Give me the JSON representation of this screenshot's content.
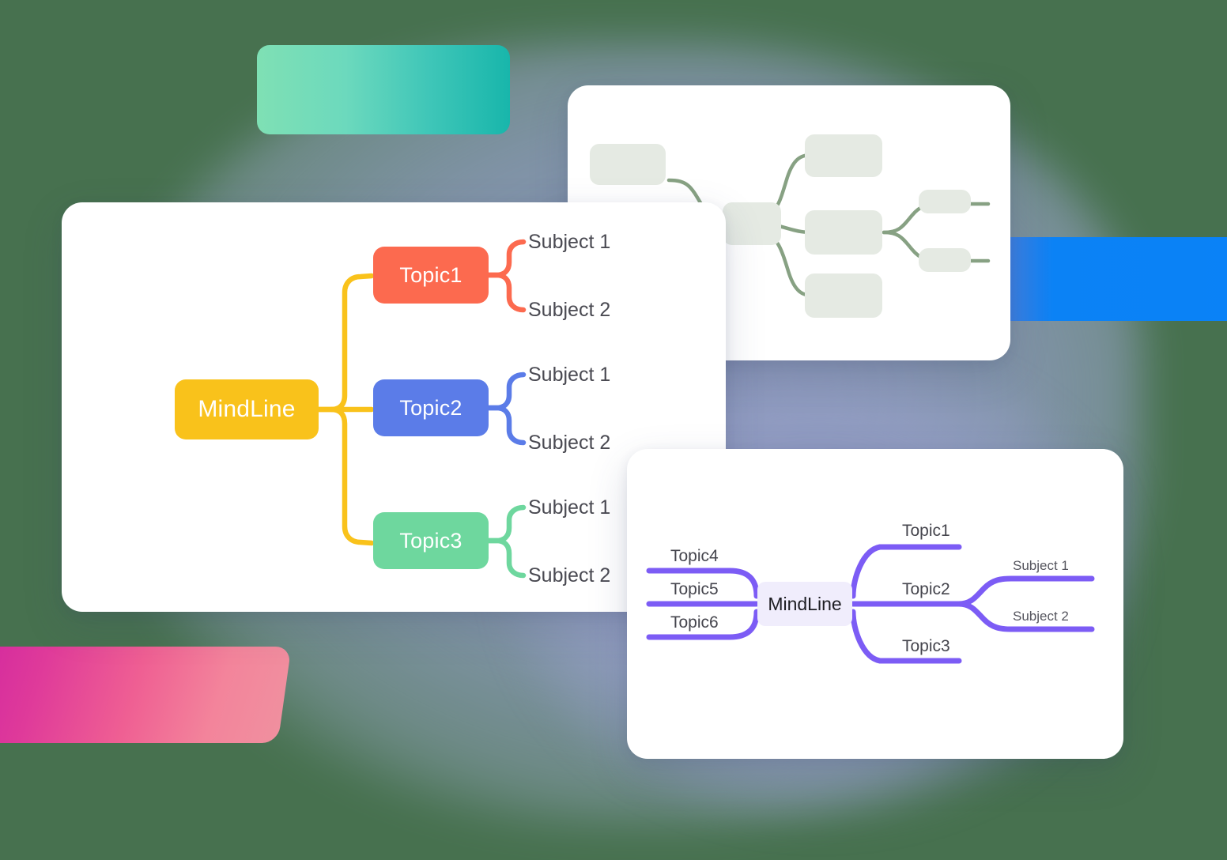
{
  "page": {
    "background_color": "#47714f",
    "title": "MindLine mind-map illustration"
  },
  "decor": {
    "green_blob": {
      "from": "#7fe0b4",
      "to": "#18b6ab"
    },
    "blue_blob": {
      "from": "#3b7fe2",
      "to": "#0a82f7"
    },
    "pink_blob": {
      "from": "#d2289f",
      "to": "#f0909f"
    },
    "haze_blob": {
      "color": "#8e96c4"
    }
  },
  "main_card": {
    "accent_root": "#f9c21b",
    "root": {
      "label": "MindLine"
    },
    "branches": [
      {
        "label": "Topic1",
        "color": "#fc6a4f",
        "leaves": [
          {
            "label": "Subject 1"
          },
          {
            "label": "Subject 2"
          }
        ]
      },
      {
        "label": "Topic2",
        "color": "#5b7ce8",
        "leaves": [
          {
            "label": "Subject 1"
          },
          {
            "label": "Subject 2"
          }
        ]
      },
      {
        "label": "Topic3",
        "color": "#6ed79e",
        "leaves": [
          {
            "label": "Subject 1"
          },
          {
            "label": "Subject 2"
          }
        ]
      }
    ]
  },
  "top_right_card": {
    "line_color": "#87a183",
    "box_color": "#e5eae3",
    "nodes": [
      {
        "name": "placeholder-left",
        "label": ""
      },
      {
        "name": "placeholder-center-root",
        "label": ""
      },
      {
        "name": "placeholder-top",
        "label": ""
      },
      {
        "name": "placeholder-middle",
        "label": ""
      },
      {
        "name": "placeholder-bottom",
        "label": ""
      },
      {
        "name": "placeholder-leaf-top",
        "label": ""
      },
      {
        "name": "placeholder-leaf-bottom",
        "label": ""
      }
    ]
  },
  "bottom_right_card": {
    "line_color": "#7c5cf5",
    "center": {
      "label": "MindLine",
      "background": "#f0edfc"
    },
    "left_branches": [
      {
        "label": "Topic4"
      },
      {
        "label": "Topic5"
      },
      {
        "label": "Topic6"
      }
    ],
    "right_branches": [
      {
        "label": "Topic1"
      },
      {
        "label": "Topic2",
        "leaves": [
          {
            "label": "Subject 1"
          },
          {
            "label": "Subject 2"
          }
        ]
      },
      {
        "label": "Topic3"
      }
    ],
    "sub_leaves": [
      {
        "label": "Subject 1"
      },
      {
        "label": "Subject 2"
      }
    ]
  }
}
